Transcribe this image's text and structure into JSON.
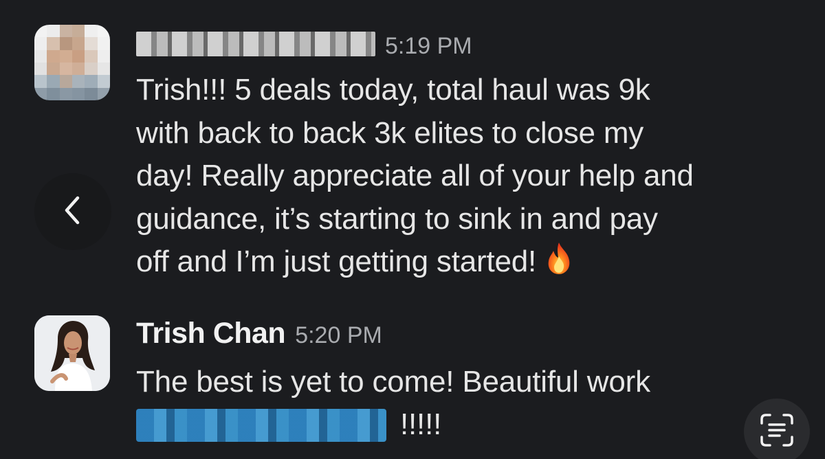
{
  "messages": [
    {
      "sender_name": "",
      "sender_redacted": true,
      "timestamp": "5:19 PM",
      "lines": [
        "Trish!!! 5 deals today, total haul was 9k",
        "with back to back 3k elites to close my",
        "day! Really appreciate all of your help and",
        "guidance, it’s starting to sink in and pay",
        "off and I’m just getting started!"
      ],
      "emoji": "fire-icon"
    },
    {
      "sender_name": "Trish Chan",
      "timestamp": "5:20 PM",
      "lines": [
        "The best is yet to come! Beautiful work"
      ],
      "mention_redacted": true,
      "suffix": "!!!!!"
    }
  ],
  "icons": {
    "back": "chevron-left-icon",
    "scan": "text-scan-icon"
  },
  "colors": {
    "background": "#1b1c1f",
    "text": "#e6e6e6",
    "timestamp": "#a9abaf",
    "mention": "#3d9bd6"
  }
}
